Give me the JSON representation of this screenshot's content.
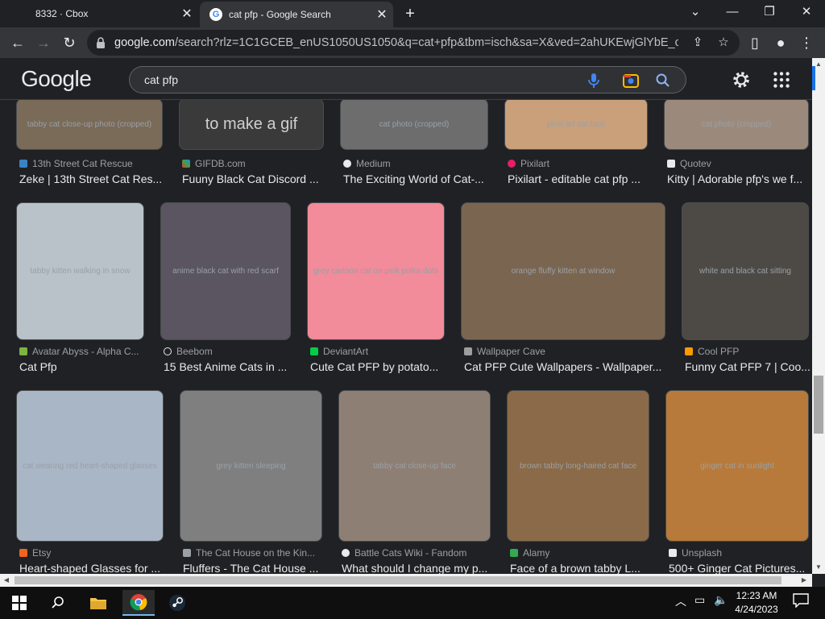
{
  "tabs": [
    {
      "title": "8332 · Cbox"
    },
    {
      "title": "cat pfp - Google Search"
    }
  ],
  "omnibox": {
    "domain": "google.com",
    "path": "/search?rlz=1C1GCEB_enUS1050US1050&q=cat+pfp&tbm=isch&sa=X&ved=2ahUKEwjGlYbE_cH-A..."
  },
  "google": {
    "logo": "Google",
    "query": "cat pfp"
  },
  "colors": {
    "accent": "#1a73e8",
    "bg": "#202124",
    "text": "#e8eaed",
    "muted": "#9aa0a6"
  },
  "results": {
    "row1": [
      {
        "source": "13th Street Cat Rescue",
        "title": "Zeke | 13th Street Cat Res...",
        "img": "tabby cat close-up photo (cropped)",
        "overlay": ""
      },
      {
        "source": "GIFDB.com",
        "title": "Fuuny Black Cat Discord ...",
        "img": "black cat gif frame",
        "overlay": "to make a gif"
      },
      {
        "source": "Medium",
        "title": "The Exciting World of Cat-...",
        "img": "cat photo (cropped)",
        "overlay": ""
      },
      {
        "source": "Pixilart",
        "title": "Pixilart - editable cat pfp ...",
        "img": "pixel art cat face",
        "overlay": ""
      },
      {
        "source": "Quotev",
        "title": "Kitty | Adorable pfp's we f...",
        "img": "cat photo (cropped)",
        "overlay": ""
      }
    ],
    "row2": [
      {
        "source": "Avatar Abyss - Alpha C...",
        "title": "Cat Pfp",
        "img": "tabby kitten walking in snow"
      },
      {
        "source": "Beebom",
        "title": "15 Best Anime Cats in ...",
        "img": "anime black cat with red scarf"
      },
      {
        "source": "DeviantArt",
        "title": "Cute Cat PFP by potato...",
        "img": "grey cartoon cat on pink polka dots"
      },
      {
        "source": "Wallpaper Cave",
        "title": "Cat PFP Cute Wallpapers - Wallpaper...",
        "img": "orange fluffy kitten at window"
      },
      {
        "source": "Cool PFP",
        "title": "Funny Cat PFP 7 | Coo...",
        "img": "white and black cat sitting"
      }
    ],
    "row3": [
      {
        "source": "Etsy",
        "title": "Heart-shaped Glasses for ...",
        "img": "cat wearing red heart-shaped glasses"
      },
      {
        "source": "The Cat House on the Kin...",
        "title": "Fluffers - The Cat House ...",
        "img": "grey kitten sleeping"
      },
      {
        "source": "Battle Cats Wiki - Fandom",
        "title": "What should I change my p...",
        "img": "tabby cat close-up face"
      },
      {
        "source": "Alamy",
        "title": "Face of a brown tabby L...",
        "img": "brown tabby long-haired cat face"
      },
      {
        "source": "Unsplash",
        "title": "500+ Ginger Cat Pictures...",
        "img": "ginger cat in sunlight"
      }
    ]
  },
  "taskbar": {
    "time": "12:23 AM",
    "date": "4/24/2023"
  }
}
